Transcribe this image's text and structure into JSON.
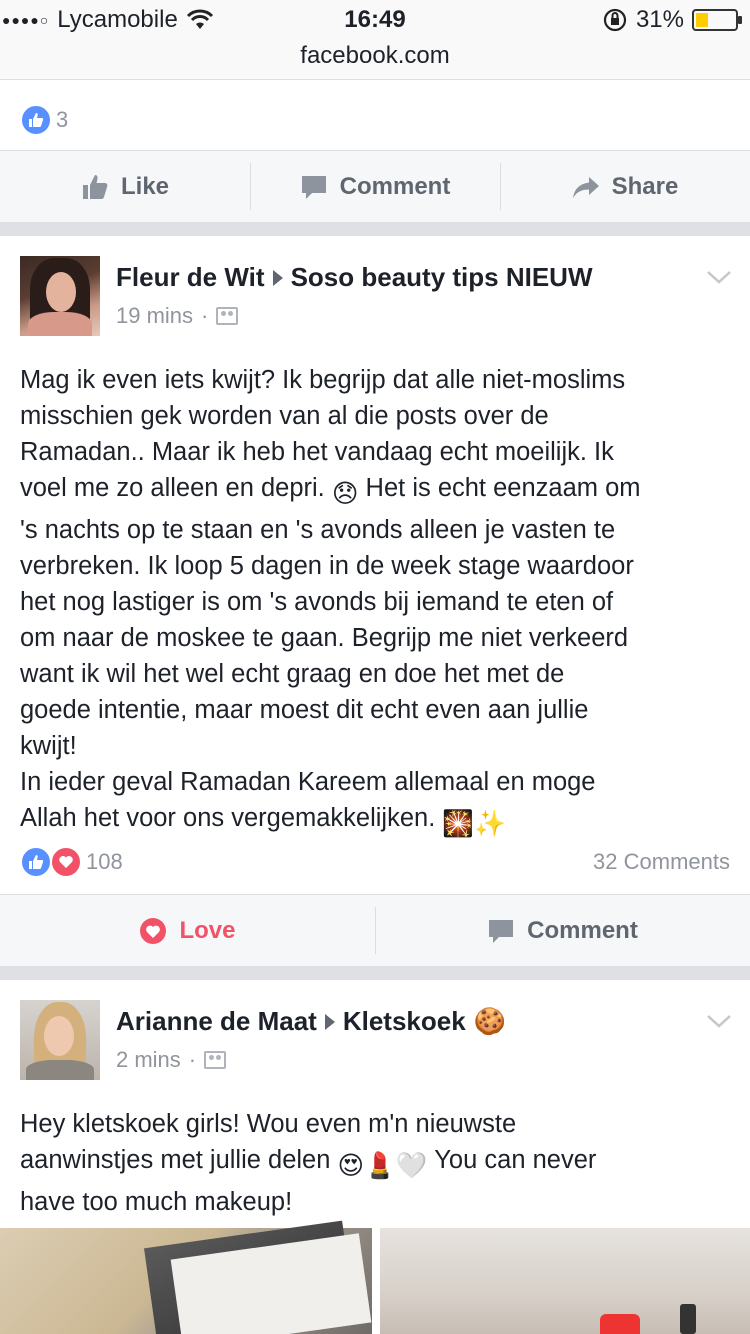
{
  "status_bar": {
    "signal_dots": "●●●●○",
    "carrier": "Lycamobile",
    "time": "16:49",
    "battery_percent": "31%",
    "battery_level": 0.31
  },
  "address_bar": {
    "url": "facebook.com"
  },
  "top_card": {
    "like_count": "3",
    "actions": {
      "like": "Like",
      "comment": "Comment",
      "share": "Share"
    }
  },
  "posts": [
    {
      "author": "Fleur de Wit",
      "group": "Soso beauty tips NIEUW",
      "time": "19 mins",
      "dot": "·",
      "text_lines": [
        "Mag ik even iets kwijt? Ik begrijp dat alle niet-moslims",
        "misschien gek worden van al die posts over de",
        "Ramadan.. Maar ik heb het vandaag echt moeilijk. Ik",
        "voel me zo alleen en depri.",
        " Het is echt eenzaam om",
        "'s nachts op te staan en 's avonds alleen je vasten te",
        "verbreken. Ik loop 5 dagen in de week stage waardoor",
        "het nog lastiger is om 's avonds bij iemand te eten of",
        "om naar de moskee te gaan. Begrijp me niet verkeerd",
        "want ik wil het wel echt graag en doe het met de",
        "goede intentie, maar moest dit echt even aan jullie",
        "kwijt!",
        "In ieder geval Ramadan Kareem allemaal en moge",
        "Allah het voor ons vergemakkelijken."
      ],
      "reaction_count": "108",
      "comments": "32 Comments",
      "actions": {
        "love": "Love",
        "comment": "Comment"
      }
    },
    {
      "author": "Arianne de Maat",
      "group": "Kletskoek",
      "time": "2 mins",
      "dot": "·",
      "text_lines": [
        "Hey kletskoek girls! Wou even m'n nieuwste",
        "aanwinstjes met jullie delen",
        " You can never",
        "have too much makeup!"
      ]
    }
  ],
  "icons": {
    "emoji_disappointed": "😞",
    "emoji_sparkle_night": "🎇",
    "emoji_sparkles": "✨",
    "emoji_cookie": "🍪",
    "emoji_heart_eyes": "😍",
    "emoji_lipstick": "💄",
    "emoji_heart": "🤍"
  },
  "colors": {
    "facebook_blue": "#5890ff",
    "love_red": "#f25268",
    "meta_gray": "#90949c"
  }
}
